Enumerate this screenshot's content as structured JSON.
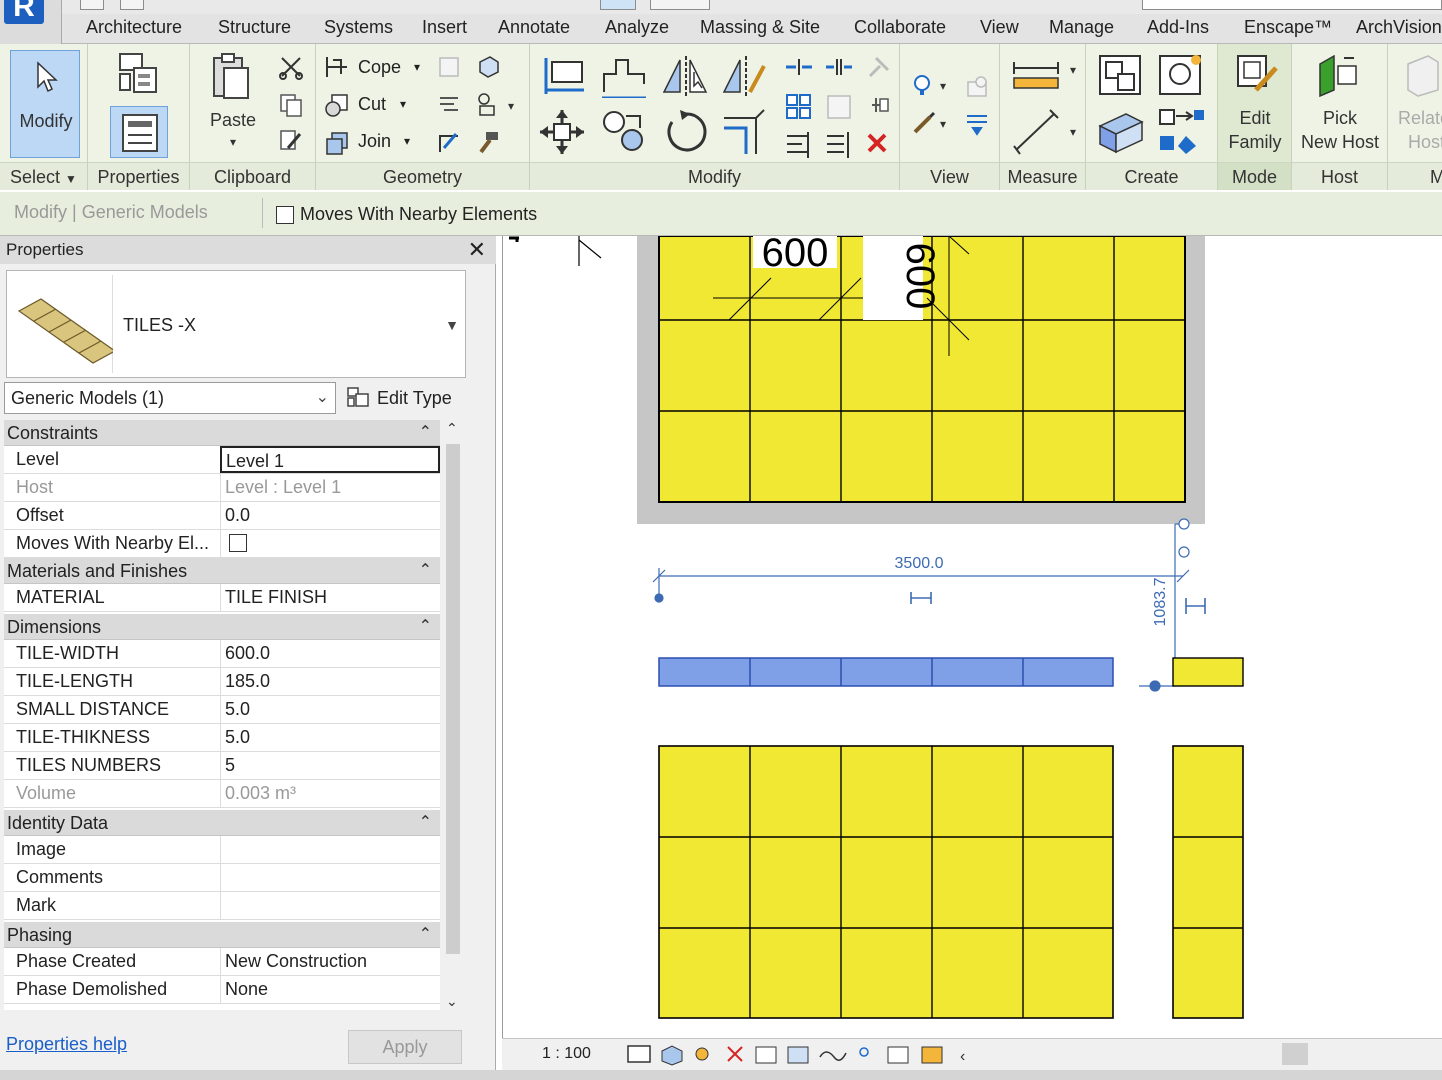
{
  "app": {
    "logo": "R"
  },
  "tabs": [
    "Architecture",
    "Structure",
    "Systems",
    "Insert",
    "Annotate",
    "Analyze",
    "Massing & Site",
    "Collaborate",
    "View",
    "Manage",
    "Add-Ins",
    "Enscape™",
    "ArchVision"
  ],
  "ribbon": {
    "select": {
      "modify": "Modify",
      "label": "Select"
    },
    "properties": {
      "label": "Properties"
    },
    "clipboard": {
      "paste": "Paste",
      "label": "Clipboard"
    },
    "geometry": {
      "cope": "Cope",
      "cut": "Cut",
      "join": "Join",
      "label": "Geometry"
    },
    "modify": {
      "label": "Modify"
    },
    "view": {
      "label": "View"
    },
    "measure": {
      "label": "Measure"
    },
    "create": {
      "label": "Create"
    },
    "mode": {
      "edit_family_1": "Edit",
      "edit_family_2": "Family",
      "label": "Mode"
    },
    "host": {
      "pick_1": "Pick",
      "pick_2": "New Host",
      "relate_1": "Relate",
      "relate_2": "Host",
      "label": "Host",
      "label_m": "M"
    }
  },
  "options_bar": {
    "context": "Modify | Generic Models",
    "checkbox_label": "Moves With Nearby Elements"
  },
  "properties": {
    "title": "Properties",
    "type_name": "TILES -X",
    "category": "Generic Models (1)",
    "edit_type": "Edit Type",
    "groups": {
      "constraints": "Constraints",
      "materials": "Materials and Finishes",
      "dimensions": "Dimensions",
      "identity": "Identity Data",
      "phasing": "Phasing"
    },
    "rows": {
      "level": {
        "k": "Level",
        "v": "Level 1"
      },
      "host": {
        "k": "Host",
        "v": "Level : Level 1"
      },
      "offset": {
        "k": "Offset",
        "v": "0.0"
      },
      "moves": {
        "k": "Moves With Nearby El..."
      },
      "material": {
        "k": "MATERIAL",
        "v": "TILE FINISH"
      },
      "tile_width": {
        "k": "TILE-WIDTH",
        "v": "600.0"
      },
      "tile_length": {
        "k": "TILE-LENGTH",
        "v": "185.0"
      },
      "small_distance": {
        "k": "SMALL DISTANCE",
        "v": "5.0"
      },
      "tile_thikness": {
        "k": "TILE-THIKNESS",
        "v": "5.0"
      },
      "tiles_numbers": {
        "k": "TILES NUMBERS",
        "v": "5"
      },
      "volume": {
        "k": "Volume",
        "v": "0.003 m³"
      },
      "image": {
        "k": "Image",
        "v": ""
      },
      "comments": {
        "k": "Comments",
        "v": ""
      },
      "mark": {
        "k": "Mark",
        "v": ""
      },
      "phase_created": {
        "k": "Phase Created",
        "v": "New Construction"
      },
      "phase_demolished": {
        "k": "Phase Demolished",
        "v": "None"
      }
    },
    "help": "Properties help",
    "apply": "Apply"
  },
  "canvas": {
    "label_600_h": "600",
    "label_600_v": "600",
    "dim_3500": "3500.0",
    "dim_1083": "1083.7"
  },
  "viewbar": {
    "scale": "1 : 100"
  },
  "colors": {
    "tile": "#f0e832",
    "selected": "#7f9fe6",
    "ribbon_bg": "#eef3e5",
    "dim": "#3d6bb3"
  }
}
